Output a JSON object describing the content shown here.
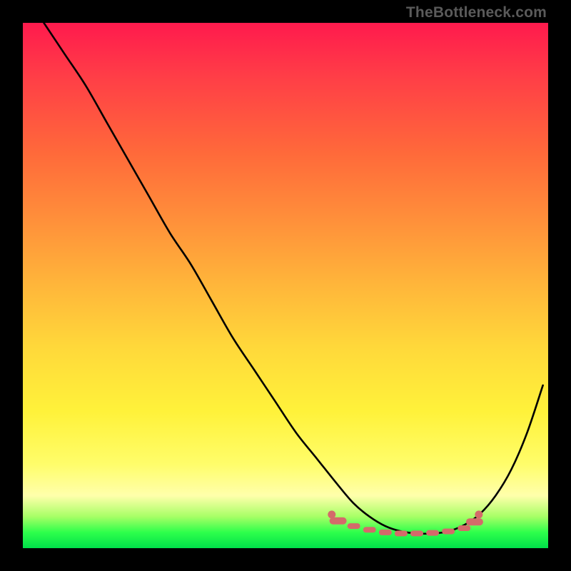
{
  "watermark": "TheBottleneck.com",
  "chart_data": {
    "type": "line",
    "title": "",
    "xlabel": "",
    "ylabel": "",
    "xlim": [
      0,
      100
    ],
    "ylim": [
      0,
      100
    ],
    "grid": false,
    "legend": false,
    "series": [
      {
        "name": "bottleneck-curve",
        "x": [
          4,
          8,
          12,
          16,
          20,
          24,
          28,
          32,
          36,
          40,
          44,
          48,
          52,
          56,
          60,
          63,
          66,
          69,
          72,
          75,
          78,
          81,
          84,
          87,
          90,
          93,
          96,
          99
        ],
        "y": [
          100,
          94,
          88,
          81,
          74,
          67,
          60,
          54,
          47,
          40,
          34,
          28,
          22,
          17,
          12,
          8.5,
          6,
          4.2,
          3.2,
          2.8,
          2.8,
          3.2,
          4.4,
          6.5,
          10,
          15,
          22,
          31
        ]
      }
    ],
    "marker_band": {
      "name": "optimal-band",
      "color": "#d46a6a",
      "x": [
        60,
        63,
        66,
        69,
        72,
        75,
        78,
        81,
        84,
        86
      ],
      "y": [
        5.2,
        4.2,
        3.5,
        3.0,
        2.8,
        2.8,
        2.9,
        3.2,
        3.8,
        5.0
      ]
    }
  }
}
